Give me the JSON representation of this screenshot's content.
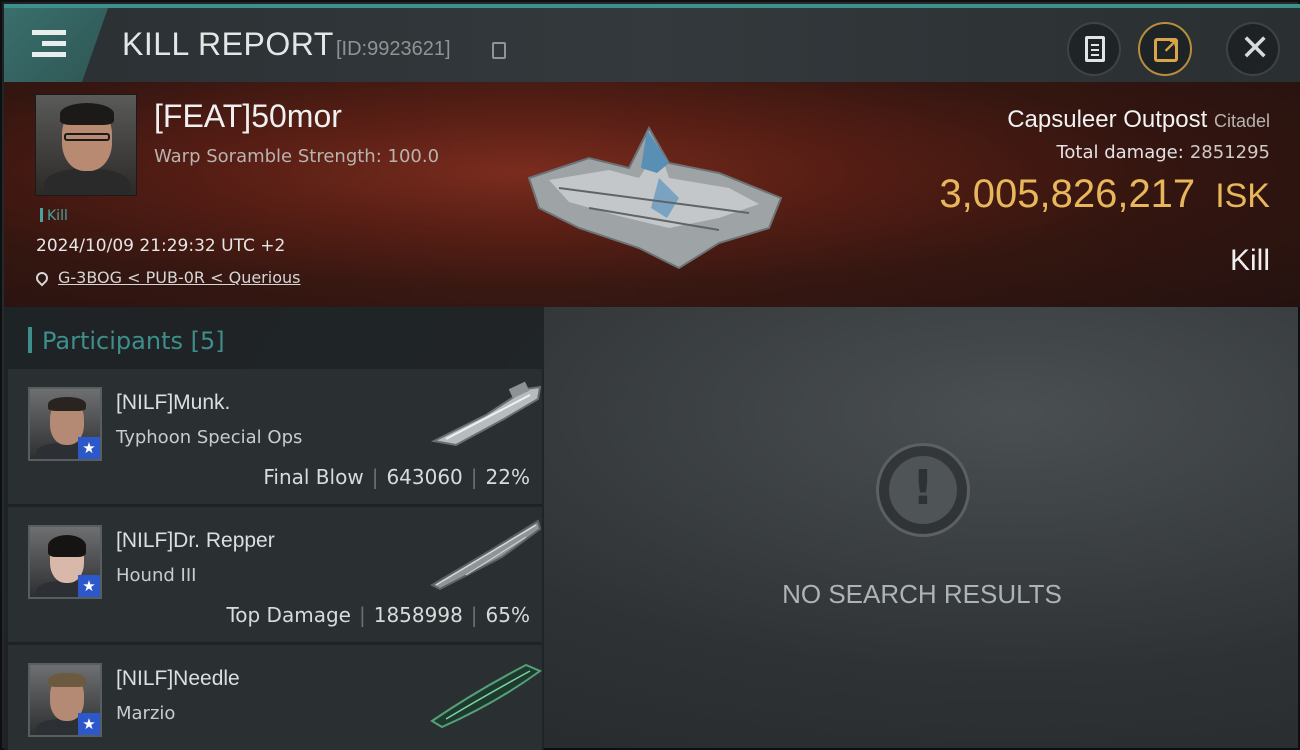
{
  "header": {
    "title": "KILL REPORT",
    "report_id": "[ID:9923621]"
  },
  "victim": {
    "name": "[FEAT]50mor",
    "subline": "Warp Soramble Strength: 100.0",
    "tag": "Kill",
    "timestamp": "2024/10/09 21:29:32 UTC +2",
    "location": "G-3BOG < PUB-0R < Querious"
  },
  "target": {
    "name": "Capsuleer Outpost",
    "type": "Citadel",
    "damage_label": "Total damage:",
    "damage_value": "2851295",
    "isk_value": "3,005,826,217",
    "isk_unit": "ISK",
    "result": "Kill"
  },
  "participants": {
    "label": "Participants",
    "count": "[5]",
    "items": [
      {
        "name": "[NILF]Munk.",
        "ship": "Typhoon Special Ops",
        "role": "Final Blow",
        "damage": "643060",
        "percent": "22%"
      },
      {
        "name": "[NILF]Dr. Repper",
        "ship": "Hound III",
        "role": "Top Damage",
        "damage": "1858998",
        "percent": "65%"
      },
      {
        "name": "[NILF]Needle",
        "ship": "Marzio"
      }
    ]
  },
  "results": {
    "empty_text": "NO SEARCH RESULTS"
  },
  "colors": {
    "accent_teal": "#3e8e8b",
    "isk_gold": "#e8b75c",
    "banner_red": "#5a1f15",
    "badge_blue": "#2d58c9"
  },
  "icons": [
    "menu-icon",
    "copy-icon",
    "clipboard-icon",
    "share-icon",
    "close-icon",
    "location-pin-icon",
    "alert-icon",
    "corp-badge-icon"
  ]
}
